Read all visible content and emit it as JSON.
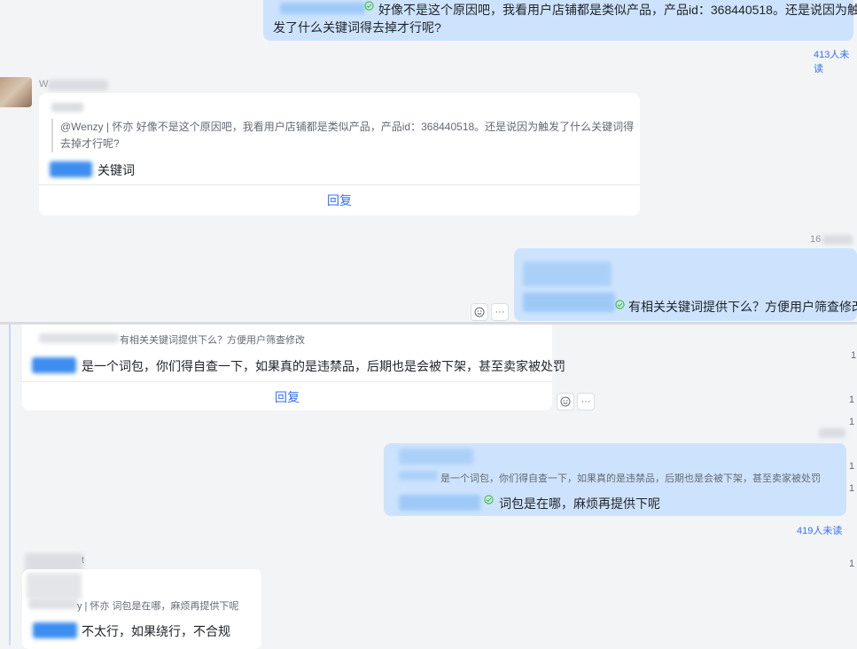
{
  "top_message": {
    "text_line1": "好像不是这个原因吧，我看用户店铺都是类似产品，产品id：368440518。还是说因为触",
    "text_line2": "发了什么关键词得去掉才行呢?",
    "read_count": "413人未读"
  },
  "card1": {
    "sender": "W",
    "quote": "@Wenzy | 怀亦 好像不是这个原因吧，我看用户店铺都是类似产品，产品id：368440518。还是说因为触发了什么关键词得去掉才行呢?",
    "reply_text": "关键词",
    "reply_button": "回复"
  },
  "time1": "16",
  "right_message2": {
    "text": "有相关关键词提供下么？方便用户筛查修改"
  },
  "card2": {
    "quote": "有相关关键词提供下么？方便用户筛查修改",
    "reply_text": "是一个词包，你们得自查一下，如果真的是违禁品，后期也是会被下架，甚至卖家被处罚",
    "reply_button": "回复"
  },
  "right_message3": {
    "quote": "是一个词包，你们得自查一下，如果真的是违禁品，后期也是会被下架，甚至卖家被处罚",
    "text": "词包是在哪，麻烦再提供下呢",
    "read_count": "419人未读"
  },
  "card3": {
    "sender_suffix": "t",
    "quote": "y | 怀亦 词包是在哪，麻烦再提供下呢",
    "reply_text": "不太行，如果绕行，不合规"
  },
  "side_digits": [
    "1",
    "1",
    "1",
    "1",
    "1",
    "1"
  ],
  "colors": {
    "accent": "#3370ff",
    "bubble": "#cde3fd",
    "background": "#f3f4f6",
    "card": "#ffffff",
    "check": "#34c724"
  },
  "icons": {
    "emoji": "smile-icon",
    "more": "more-icon",
    "read": "check-circle-icon"
  },
  "toolbar_more_label": "···"
}
